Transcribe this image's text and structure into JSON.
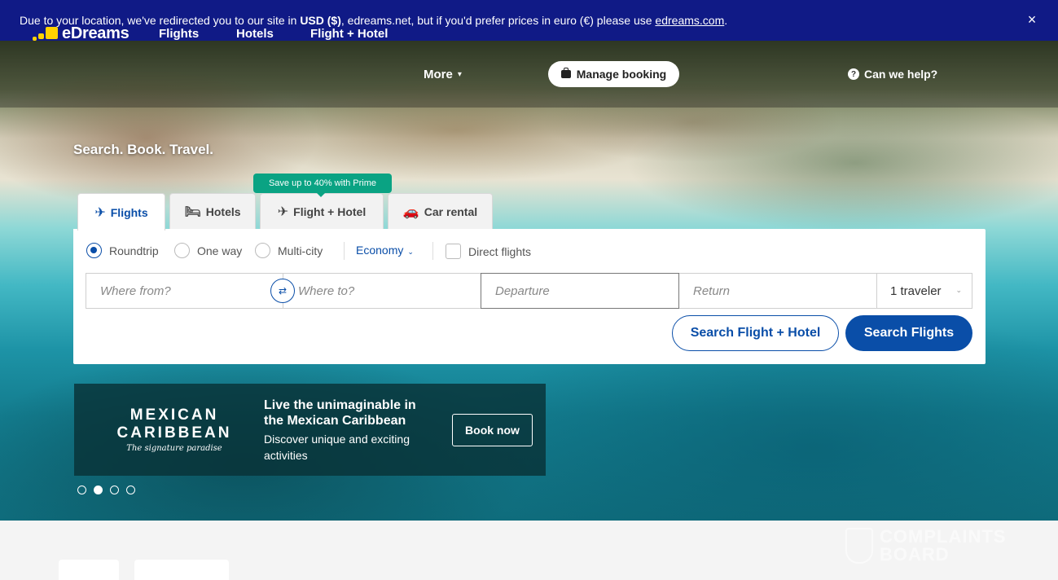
{
  "notice": {
    "text_before": "Due to your location, we've redirected you to our site in ",
    "currency": "USD ($)",
    "text_middle": ", edreams.net, but if you'd prefer prices in euro (€) please use ",
    "link": "edreams.com",
    "text_after": ".",
    "close_icon": "×"
  },
  "nav": {
    "logo": "eDreams",
    "items": [
      "Flights",
      "Hotels",
      "Flight + Hotel",
      "More"
    ],
    "manage_booking": "Manage booking",
    "help": "Can we help?"
  },
  "hero": {
    "tagline": "Search. Book. Travel."
  },
  "search": {
    "prime_badge": "Save up to 40% with Prime",
    "tabs": [
      "Flights",
      "Hotels",
      "Flight + Hotel",
      "Car rental"
    ],
    "trip_types": [
      "Roundtrip",
      "One way",
      "Multi-city"
    ],
    "cabin": "Economy",
    "direct_flights": "Direct flights",
    "from_placeholder": "Where from?",
    "to_placeholder": "Where to?",
    "departure_placeholder": "Departure",
    "return_placeholder": "Return",
    "travelers": "1 traveler",
    "btn_flight_hotel": "Search Flight + Hotel",
    "btn_flights": "Search Flights"
  },
  "promo": {
    "logo_line1": "MEXICAN",
    "logo_line2": "CARIBBEAN",
    "logo_line3": "The signature paradise",
    "title": "Live the unimaginable in the Mexican Caribbean",
    "subtitle": "Discover unique and exciting activities",
    "button": "Book now"
  },
  "carousel": {
    "total": 4,
    "active": 2
  },
  "watermark": {
    "line1": "COMPLAINTS",
    "line2": "BOARD"
  },
  "colors": {
    "brand_blue": "#0a4ea8",
    "notice_bg": "#101a86",
    "prime_green": "#0aa383",
    "logo_yellow": "#ffd200"
  }
}
